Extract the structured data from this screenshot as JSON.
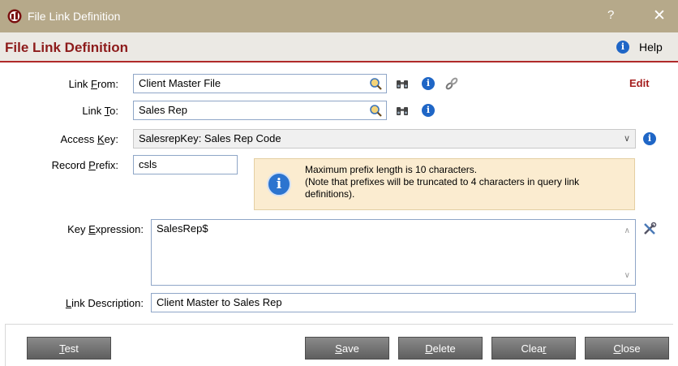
{
  "window": {
    "title": "File Link Definition",
    "help_glyph": "?",
    "close_glyph": "✕"
  },
  "header": {
    "title": "File Link Definition",
    "help_label": "Help",
    "help_icon": "info-icon"
  },
  "form": {
    "link_from": {
      "label_pre": "Link ",
      "label_key": "F",
      "label_post": "rom:",
      "value": "Client Master File"
    },
    "link_to": {
      "label_pre": "Link ",
      "label_key": "T",
      "label_post": "o:",
      "value": "Sales Rep"
    },
    "access_key": {
      "label_pre": "Access ",
      "label_key": "K",
      "label_post": "ey:",
      "value": "SalesrepKey: Sales Rep Code"
    },
    "record_prefix": {
      "label_pre": "Record ",
      "label_key": "P",
      "label_post": "refix:",
      "value": "csls"
    },
    "key_expression": {
      "label_pre": "Key ",
      "label_key": "E",
      "label_post": "xpression:",
      "value": "SalesRep$"
    },
    "link_description": {
      "label_pre": "",
      "label_key": "L",
      "label_post": "ink Description:",
      "value": "Client Master to Sales Rep"
    },
    "edit_label": "Edit",
    "icons": [
      "search-icon",
      "binoculars-icon",
      "info-icon",
      "link-icon",
      "tools-icon"
    ]
  },
  "notice": {
    "line1": "Maximum prefix length is 10 characters.",
    "line2": "(Note that prefixes will be truncated to 4 characters in query link definitions)."
  },
  "buttons": {
    "test": {
      "key": "T",
      "rest": "est"
    },
    "save": {
      "key": "S",
      "rest": "ave"
    },
    "delete": {
      "key": "D",
      "rest": "elete"
    },
    "clear": {
      "pre": "Clea",
      "key": "r"
    },
    "close": {
      "key": "C",
      "rest": "lose"
    }
  },
  "colors": {
    "titlebar": "#b6a98a",
    "accent_red": "#8d1b1b",
    "info_blue": "#1f66c6",
    "notice_bg": "#fbecd0"
  }
}
